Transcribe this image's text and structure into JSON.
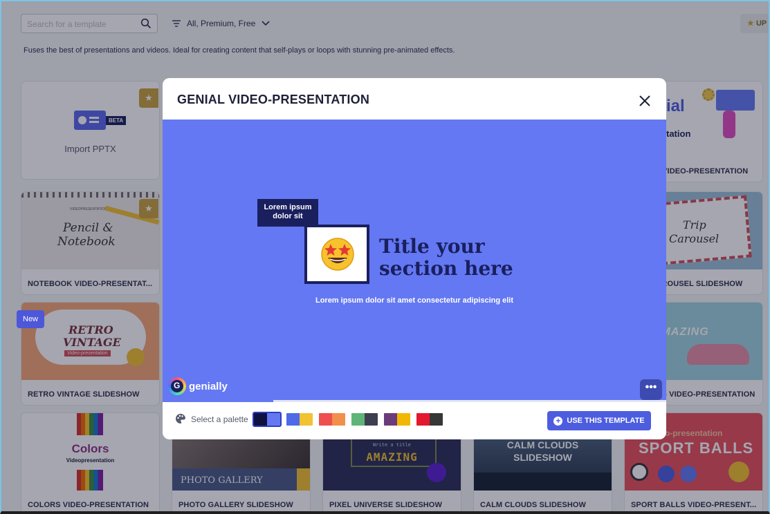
{
  "toolbar": {
    "search_placeholder": "Search for a template",
    "filter_label": "All, Premium, Free",
    "upgrade_label": "UP"
  },
  "description": "Fuses the best of presentations and videos. Ideal for creating content that self-plays or loops with stunning pre-animated effects.",
  "cards": {
    "import": {
      "label": "Import PPTX",
      "badge": "BETA"
    },
    "genial": {
      "caption": "GENIAL VIDEO-PRESENTATION",
      "thumb_title": "ial",
      "thumb_sub": "tation"
    },
    "notebook": {
      "caption": "NOTEBOOK VIDEO-PRESENTAT...",
      "thumb_top": "VIDEOPRESENTATION",
      "thumb_title_1": "Pencil &",
      "thumb_title_2": "Notebook"
    },
    "trip": {
      "caption": "TRIP CAROUSEL SLIDESHOW",
      "thumb_title_1": "Trip",
      "thumb_title_2": "Carousel"
    },
    "retro": {
      "caption": "RETRO VINTAGE SLIDESHOW",
      "badge": "New",
      "thumb_title_1": "RETRO",
      "thumb_title_2": "VINTAGE",
      "thumb_sub": "Video-presentation"
    },
    "amazing_right": {
      "caption": "AMAZING VIDEO-PRESENTATION",
      "thumb_title": "AMAZING"
    },
    "colors": {
      "caption": "COLORS VIDEO-PRESENTATION",
      "thumb_title": "Colors",
      "thumb_sub": "Videopresentation"
    },
    "photo": {
      "caption": "PHOTO GALLERY SLIDESHOW",
      "thumb_title": "PHOTO GALLERY"
    },
    "pixel": {
      "caption": "PIXEL UNIVERSE SLIDESHOW",
      "thumb_small": "Write a title",
      "thumb_title": "AMAZING"
    },
    "calm": {
      "caption": "CALM CLOUDS SLIDESHOW",
      "thumb_title_1": "CALM CLOUDS",
      "thumb_title_2": "SLIDESHOW"
    },
    "sport": {
      "caption": "SPORT BALLS VIDEO-PRESENT...",
      "thumb_small": "o-presentation",
      "thumb_title": "SPORT BALLS"
    }
  },
  "modal": {
    "title": "GENIAL VIDEO-PRESENTATION",
    "preview": {
      "tag": "Lorem ipsum dolor sit",
      "section_title": "Title your section here",
      "subtitle": "Lorem ipsum dolor sit amet consectetur adipiscing elit",
      "brand": "genially",
      "more_label": "•••"
    },
    "progress_fraction": 0.22,
    "palette_label": "Select a palette",
    "use_button": "USE THIS TEMPLATE",
    "palettes": [
      {
        "colors": [
          "#0f1140",
          "#6378f2"
        ],
        "selected": true
      },
      {
        "colors": [
          "#4e6ae6",
          "#f1c232"
        ],
        "selected": false
      },
      {
        "colors": [
          "#ef4f4f",
          "#f28f4a"
        ],
        "selected": false
      },
      {
        "colors": [
          "#5fb578",
          "#3e3e52"
        ],
        "selected": false
      },
      {
        "colors": [
          "#6a3d7a",
          "#f2b705"
        ],
        "selected": false
      },
      {
        "colors": [
          "#e3182f",
          "#373737"
        ],
        "selected": false
      }
    ]
  },
  "colors": {
    "accent": "#4d5de0",
    "preview_bg": "#6378f2",
    "dark_navy": "#1a1f5e",
    "premium_star": "#c8a23e"
  },
  "icons": [
    "search-icon",
    "filter-icon",
    "chevron-down-icon",
    "star-icon",
    "close-icon",
    "palette-icon",
    "plus-circle-icon",
    "genially-logo-icon"
  ]
}
